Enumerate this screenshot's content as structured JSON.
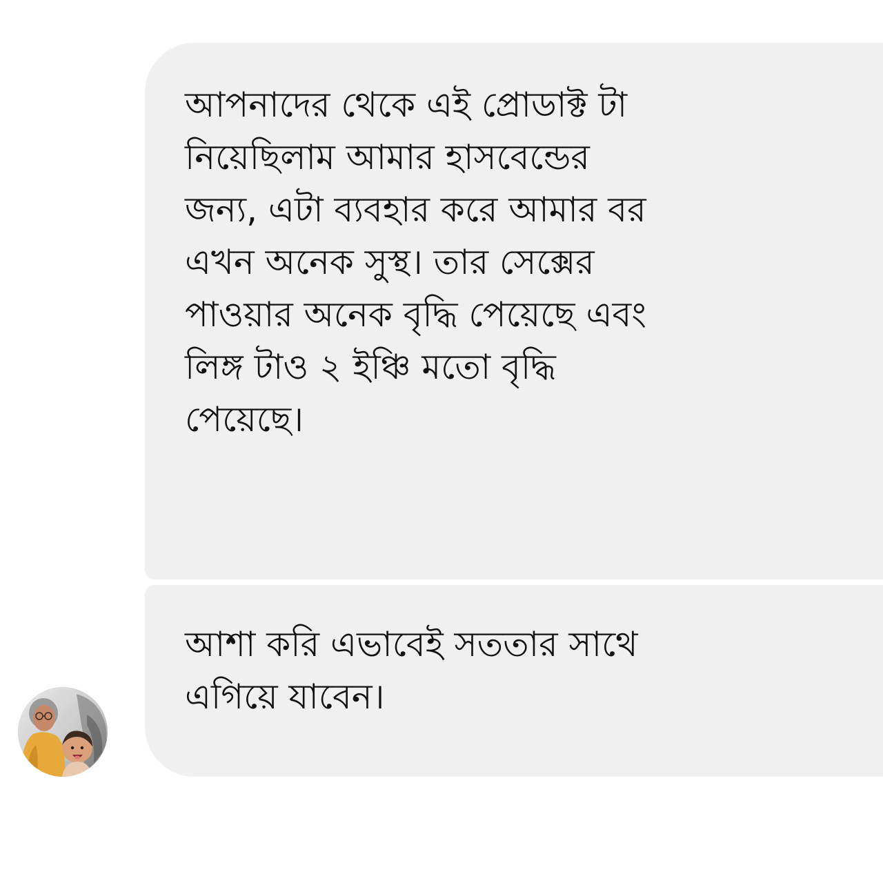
{
  "conversation": {
    "messages": [
      {
        "lines": [
          "আপনাদের থেকে এই প্রোডাক্ট টা",
          "নিয়েছিলাম আমার হাসবেন্ডের",
          "জন্য, এটা ব্যবহার করে আমার বর",
          "এখন অনেক সুস্থ। তার সেক্সের",
          "পাওয়ার অনেক বৃদ্ধি পেয়েছে এবং",
          "লিঙ্গ টাও ২ ইঞ্চি মতো বৃদ্ধি",
          "পেয়েছে।"
        ]
      },
      {
        "lines": [
          "আশা করি এভাবেই সততার সাথে",
          "এগিয়ে যাবেন।"
        ]
      }
    ],
    "colors": {
      "bubble_background": "#f0f0f0",
      "text": "#111111",
      "page_background": "#ffffff"
    },
    "sender_avatar_icon": "profile-photo-avatar"
  }
}
